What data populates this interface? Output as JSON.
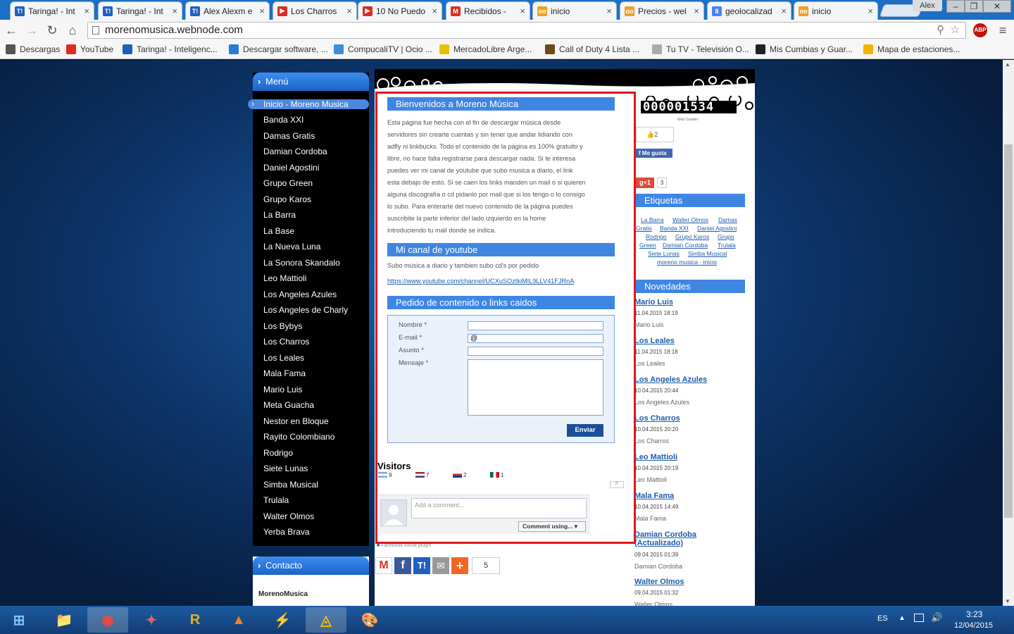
{
  "browser": {
    "tabs": [
      {
        "label": "Taringa! - Int",
        "icon": "taringa-icon",
        "color": "#1e5fbf"
      },
      {
        "label": "Taringa! - Int",
        "icon": "taringa-icon",
        "color": "#1e5fbf"
      },
      {
        "label": "Alex Alexm e",
        "icon": "taringa-icon",
        "color": "#1e5fbf"
      },
      {
        "label": "Los Charros",
        "icon": "youtube-icon",
        "color": "#e02a20"
      },
      {
        "label": "10 No Puedo",
        "icon": "youtube-icon",
        "color": "#e02a20"
      },
      {
        "label": "Recibidos - ",
        "icon": "gmail-icon",
        "color": "#d93025"
      },
      {
        "label": "inicio",
        "icon": "webnode-icon",
        "color": "#f0a020"
      },
      {
        "label": "Precios - wel",
        "icon": "webnode-icon",
        "color": "#f0a020"
      },
      {
        "label": "geolocalizad",
        "icon": "google-icon",
        "color": "#4285f4"
      },
      {
        "label": "inicio",
        "icon": "webnode-icon",
        "color": "#f0a020"
      }
    ],
    "user": "Alex",
    "url": "morenomusica.webnode.com",
    "abp_label": "ABP",
    "bookmarks": [
      {
        "label": "Descargas",
        "icon": "download-icon",
        "color": "#555555"
      },
      {
        "label": "YouTube",
        "icon": "youtube-icon",
        "color": "#e02a20"
      },
      {
        "label": "Taringa! - Inteligenc...",
        "icon": "taringa-icon",
        "color": "#1e5fbf"
      },
      {
        "label": "Descargar software, ...",
        "icon": "softonic-icon",
        "color": "#2a7bd6"
      },
      {
        "label": "CompucaliTV | Ocio ...",
        "icon": "compucali-icon",
        "color": "#3a8fd6"
      },
      {
        "label": "MercadoLibre Arge...",
        "icon": "mercadolibre-icon",
        "color": "#e6c200"
      },
      {
        "label": "Call of Duty 4 Lista ...",
        "icon": "cod-icon",
        "color": "#6b4a1e"
      },
      {
        "label": "Tu TV - Televisión O...",
        "icon": "page-icon",
        "color": "#aaaaaa"
      },
      {
        "label": "Mis Cumbias y Guar...",
        "icon": "cumbia-icon",
        "color": "#222222"
      },
      {
        "label": "Mapa de estaciones...",
        "icon": "map-icon",
        "color": "#f0b400"
      }
    ]
  },
  "site": {
    "menu_title": "Menú",
    "menu_active": "Inicio - Moreno Musica",
    "menu_items": [
      "Banda XXI",
      "Damas Gratis",
      "Damian Cordoba",
      "Daniel Agostini",
      "Grupo Green",
      "Grupo Karos",
      "La Barra",
      "La Base",
      "La Nueva Luna",
      "La Sonora Skandalo",
      "Leo Mattioli",
      "Los Angeles Azules",
      "Los Angeles de Charly",
      "Los Bybys",
      "Los Charros",
      "Los Leales",
      "Mala Fama",
      "Mario Luis",
      "Meta Guacha",
      "Nestor en Bloque",
      "Rayito Colombiano",
      "Rodrigo",
      "Siete Lunas",
      "Simba Musical",
      "Trulala",
      "Walter Olmos",
      "Yerba Brava"
    ],
    "contact_title": "Contacto",
    "contact_name": "MorenoMusica",
    "welcome_title": "Bienvenidos a Moreno Música",
    "welcome_lines": [
      "Esta página fue hecha con el fin de descargar música desde",
      "servidores sin crearte cuentas y sin tener que andar lidiando con",
      "adfly ni linkbucks. Todo el contenido de la página es 100% gratuito y",
      "libre, no hace falta registrarse para descargar nada. Si te interesa",
      "puedes ver mi canal de youtube que subo musica a diario, el link",
      "esta debajo de esto. Si se caen los links manden un mail o si quieren",
      "alguna discografía o cd pidanlo por mail que si los tengo o lo consigo",
      "lo subo. Para enterarte del nuevo contenido de la página puedes",
      "suscribite la parte inferior del lado izquierdo en la home",
      "introduciendo tu mail donde se indica."
    ],
    "youtube_title": "Mi canal de youtube",
    "youtube_text": "Subo música a diario y tambien subo cd's por pedido",
    "youtube_link": "https://www.youtube.com/channel/UCXuSOztkiMIL9LLV41FJRnA",
    "request_title": "Pedido de contenido o links caidos",
    "form": {
      "name_label": "Nombre *",
      "email_label": "E-mail *",
      "email_value": "@",
      "subject_label": "Asunto *",
      "message_label": "Mensaje *",
      "submit": "Enviar"
    },
    "visitors_title": "Visitors",
    "visitors": [
      {
        "flag": "argentina-flag-icon",
        "count": "9"
      },
      {
        "flag": "usa-flag-icon",
        "count": "7"
      },
      {
        "flag": "chile-flag-icon",
        "count": "2"
      },
      {
        "flag": "mexico-flag-icon",
        "count": "1"
      }
    ],
    "comment_placeholder": "Add a comment...",
    "comment_using": "Comment using...",
    "fb_plugin": "Facebook social plugin",
    "share_count": "5",
    "counter": "000001534",
    "counter_caption": "Web Counter",
    "like_count": "2",
    "like_label": "Me gusta",
    "gplus_label": "g+1",
    "gplus_count": "3",
    "tags_title": "Etiquetas",
    "tags_lines": [
      [
        "La Barra",
        "Walter Olmos",
        "Damas"
      ],
      [
        "Gratis",
        "Banda XXI",
        "Daniel Agostini"
      ],
      [
        "Rodrigo",
        "Grupo Karos",
        "Grupo"
      ],
      [
        "Green",
        "Damian Cordoba",
        "Trulala"
      ],
      [
        "Siete Lunas",
        "Simba Musical"
      ],
      [
        "moreno musica - inicio"
      ]
    ],
    "news_title": "Novedades",
    "news": [
      {
        "title": "Mario Luis",
        "date": "11.04.2015 18:19",
        "sub": "Mario Luis"
      },
      {
        "title": "Los Leales",
        "date": "11.04.2015 18:18",
        "sub": "Los Leales"
      },
      {
        "title": "Los Angeles Azules",
        "date": "10.04.2015 20:44",
        "sub": "Los Angeles Azules"
      },
      {
        "title": "Los Charros",
        "date": "10.04.2015 20:20",
        "sub": "Los Charros"
      },
      {
        "title": "Leo Mattioli",
        "date": "10.04.2015 20:19",
        "sub": "Leo Mattioli"
      },
      {
        "title": "Mala Fama",
        "date": "10.04.2015 14:49",
        "sub": "Mala Fama"
      },
      {
        "title": "Damian Cordoba (Actualizado)",
        "date": "09.04.2015 01:39",
        "sub": "Damian Cordoba"
      },
      {
        "title": "Walter Olmos",
        "date": "09.04.2015 01:32",
        "sub": "Walter Olmos"
      }
    ]
  },
  "taskbar": {
    "lang": "ES",
    "time": "3:23",
    "date": "12/04/2015",
    "apps": [
      "start-icon",
      "file-explorer-icon",
      "chrome-icon",
      "paint-app-icon",
      "r-app-icon",
      "vlc-icon",
      "thunder-icon",
      "ares-icon",
      "paint-icon"
    ]
  },
  "colors": {
    "accent": "#3f86e3",
    "frame": "#e2141e",
    "link": "#1d5da8"
  }
}
